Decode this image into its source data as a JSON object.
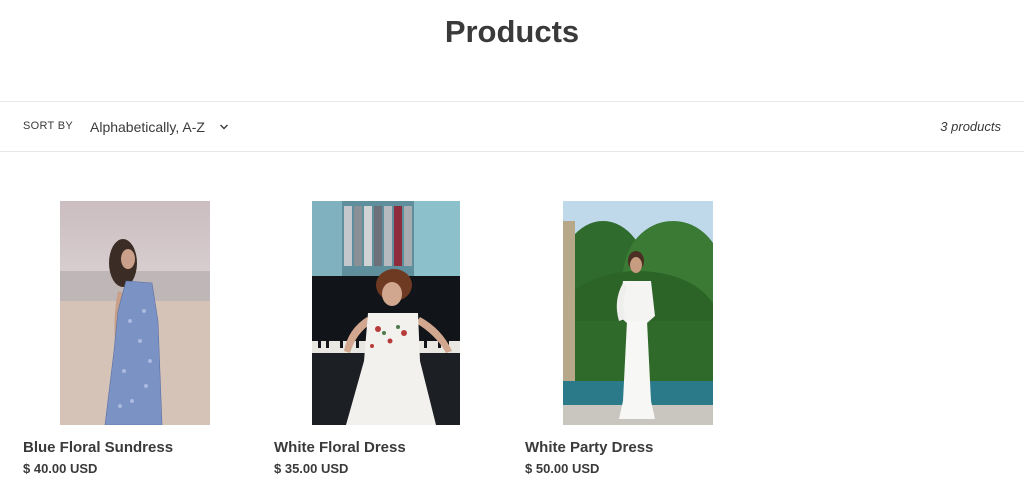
{
  "page": {
    "title": "Products"
  },
  "toolbar": {
    "sort_label": "SORT BY",
    "sort_value": "Alphabetically, A-Z",
    "product_count": "3 products"
  },
  "products": [
    {
      "name": "Blue Floral Sundress",
      "price": "$ 40.00 USD",
      "image_icon": "beach-photo"
    },
    {
      "name": "White Floral Dress",
      "price": "$ 35.00 USD",
      "image_icon": "piano-photo"
    },
    {
      "name": "White Party Dress",
      "price": "$ 50.00 USD",
      "image_icon": "garden-photo"
    }
  ]
}
